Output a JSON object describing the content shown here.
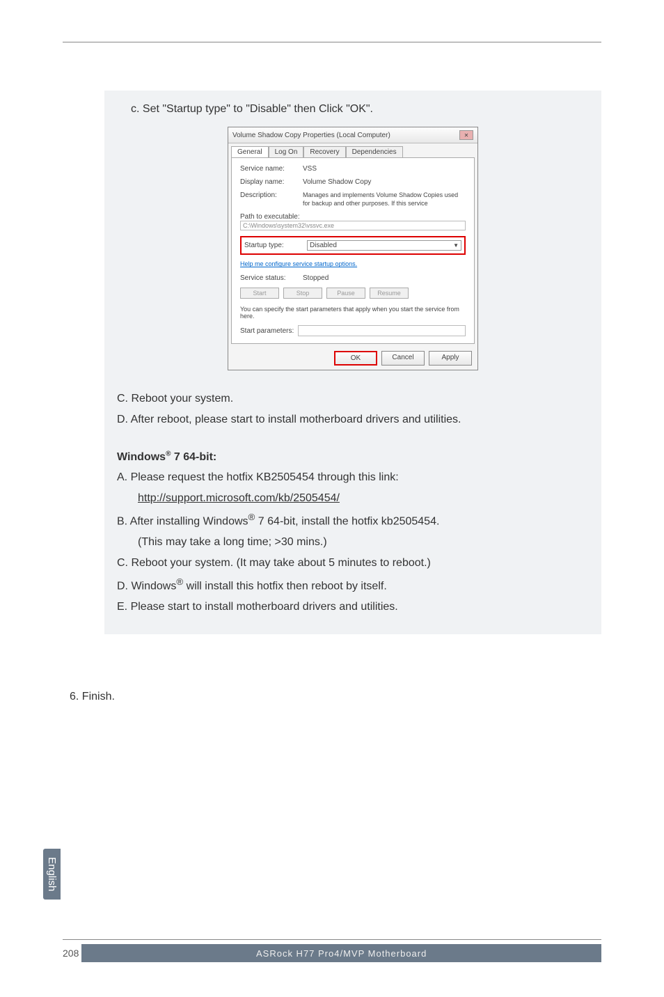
{
  "step_c_instruction": "c. Set \"Startup type\" to \"Disable\" then Click \"OK\".",
  "dialog": {
    "title": "Volume Shadow Copy Properties (Local Computer)",
    "close_icon": "✕",
    "tabs": [
      "General",
      "Log On",
      "Recovery",
      "Dependencies"
    ],
    "service_name_label": "Service name:",
    "service_name_value": "VSS",
    "display_name_label": "Display name:",
    "display_name_value": "Volume Shadow Copy",
    "description_label": "Description:",
    "description_value": "Manages and implements Volume Shadow Copies used for backup and other purposes. If this service",
    "path_label": "Path to executable:",
    "path_value": "C:\\Windows\\system32\\vssvc.exe",
    "startup_label": "Startup type:",
    "startup_value": "Disabled",
    "help_link": "Help me configure service startup options.",
    "status_label": "Service status:",
    "status_value": "Stopped",
    "btn_start": "Start",
    "btn_stop": "Stop",
    "btn_pause": "Pause",
    "btn_resume": "Resume",
    "hint": "You can specify the start parameters that apply when you start the service from here.",
    "params_label": "Start parameters:",
    "btn_ok": "OK",
    "btn_cancel": "Cancel",
    "btn_apply": "Apply"
  },
  "steps_after": {
    "c": "C. Reboot your system.",
    "d": "D. After reboot, please start to install motherboard drivers and utilities."
  },
  "win64": {
    "heading_prefix": "Windows",
    "heading_suffix": " 7 64-bit:",
    "a": "A. Please request the hotfix KB2505454 through this link:",
    "a_url": "http://support.microsoft.com/kb/2505454/",
    "b_prefix": "B. After installing Windows",
    "b_suffix": " 7 64-bit, install the hotfix kb2505454.",
    "b_note": "(This may take a long time; >30 mins.)",
    "c": "C. Reboot your system. (It may take about 5 minutes to reboot.)",
    "d_prefix": "D. Windows",
    "d_suffix": " will install this hotfix then reboot by itself.",
    "e": "E. Please start to install motherboard drivers and utilities."
  },
  "finish": "6. Finish.",
  "language_tab": "English",
  "page_number": "208",
  "footer_text": "ASRock  H77  Pro4/MVP  Motherboard"
}
